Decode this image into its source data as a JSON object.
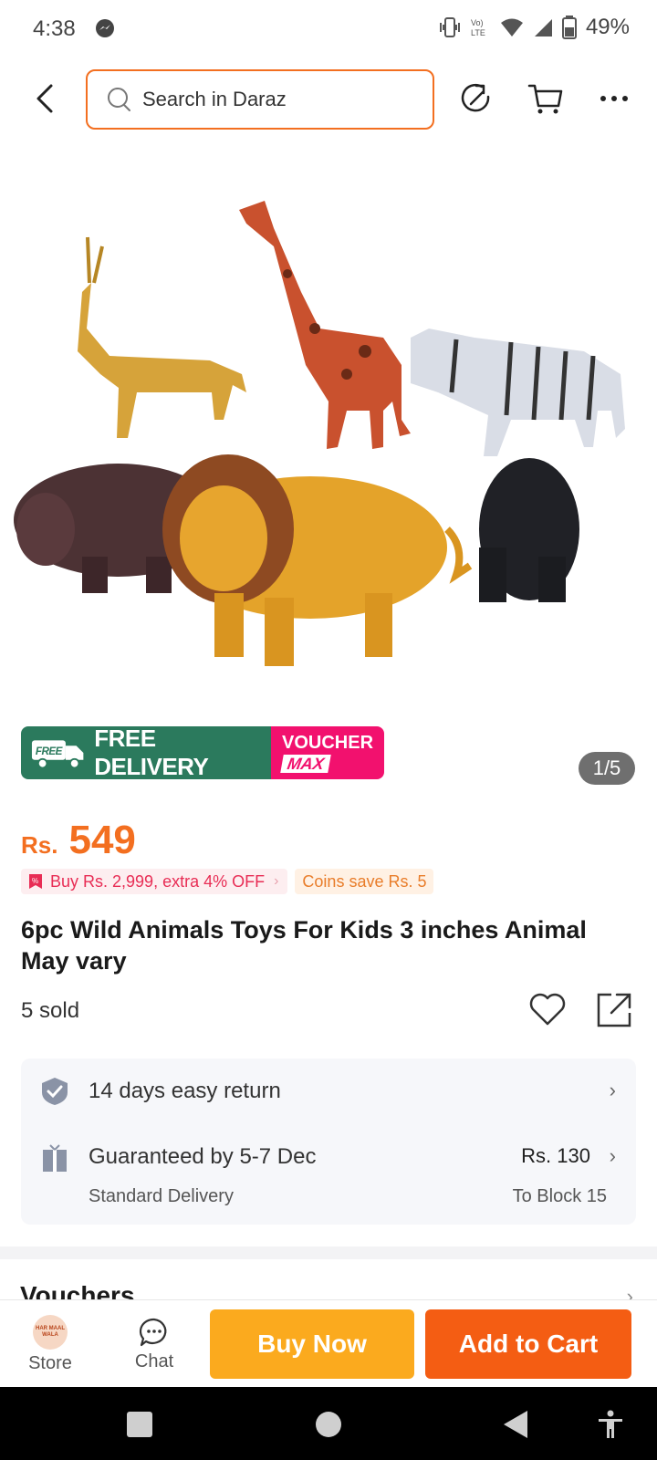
{
  "status_bar": {
    "time": "4:38",
    "battery": "49%",
    "network_label": "Vo) LTE"
  },
  "header": {
    "search_placeholder": "Search in Daraz",
    "icons": [
      "back-arrow-icon",
      "search-icon",
      "rotate-icon",
      "cart-icon",
      "more-icon"
    ]
  },
  "product": {
    "image_alt": "6 wild animal toys: giraffe, antelope, zebra, hippo, lion, bear",
    "image_counter": "1/5",
    "badge_free_delivery": "FREE DELIVERY",
    "badge_free_small": "FREE",
    "badge_voucher": "VOUCHER",
    "badge_max": "MAX",
    "price_currency": "Rs.",
    "price_amount": "549",
    "promo_text": "Buy Rs. 2,999, extra 4% OFF",
    "coins_text": "Coins save Rs. 5",
    "title": "6pc Wild Animals Toys For Kids 3 inches Animal May vary",
    "sold": "5 sold"
  },
  "services": {
    "return_text": "14 days easy return",
    "delivery_text": "Guaranteed by 5-7 Dec",
    "delivery_sub": "Standard Delivery",
    "delivery_price": "Rs. 130",
    "delivery_dest": "To Block 15"
  },
  "vouchers": {
    "title": "Vouchers"
  },
  "action_bar": {
    "store_label": "Store",
    "store_logo_text": "HAR MAAL WALA",
    "chat_label": "Chat",
    "buy_now": "Buy Now",
    "add_to_cart": "Add to Cart"
  },
  "colors": {
    "accent_orange": "#f36f20",
    "buy_now": "#fbaa1e",
    "add_to_cart": "#f45d13",
    "free_delivery_green": "#2b7a5d",
    "voucher_pink": "#f2116e"
  }
}
